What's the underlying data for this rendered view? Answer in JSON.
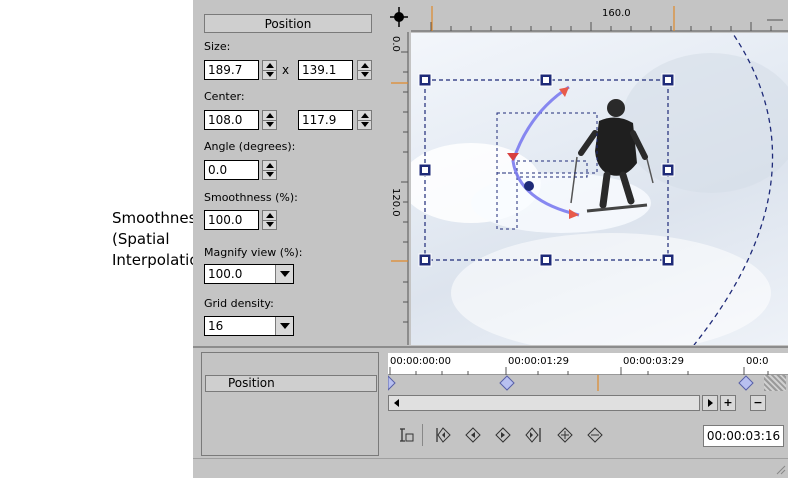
{
  "callout": {
    "line1": "Smoothness",
    "line2": "(Spatial",
    "line3": "Interpolation)"
  },
  "panel": {
    "header": "Position",
    "size_label": "Size:",
    "size_w": "189.7",
    "size_x": "x",
    "size_h": "139.1",
    "center_label": "Center:",
    "center_x": "108.0",
    "center_y": "117.9",
    "angle_label": "Angle (degrees):",
    "angle_value": "0.0",
    "smoothness_label": "Smoothness (%):",
    "smoothness_value": "100.0",
    "magnify_label": "Magnify view (%):",
    "magnify_value": "100.0",
    "grid_label": "Grid density:",
    "grid_value": "16"
  },
  "rulers": {
    "top_label": "160.0",
    "left_label_top": "0.0",
    "left_label_mid": "120.0"
  },
  "timeline": {
    "track_label": "Position",
    "t0": "00:00:00:00",
    "t1": "00:00:01:29",
    "t2": "00:00:03:29",
    "t3": "00:0",
    "current_time": "00:00:03:16",
    "plus": "+",
    "minus": "−"
  },
  "icons": {
    "crosshair": "crosshair-icon",
    "first_key": "first-keyframe-icon",
    "prev_key": "previous-keyframe-icon",
    "next_key": "next-keyframe-icon",
    "last_key": "last-keyframe-icon",
    "add_key": "add-keyframe-icon",
    "remove_key": "remove-keyframe-icon",
    "sync": "sync-cursor-icon"
  },
  "colors": {
    "window_bg": "#c4c4c4",
    "handle": "#1e2a78",
    "path": "#7b7bf0",
    "keyframe": "#b8c0f0"
  }
}
